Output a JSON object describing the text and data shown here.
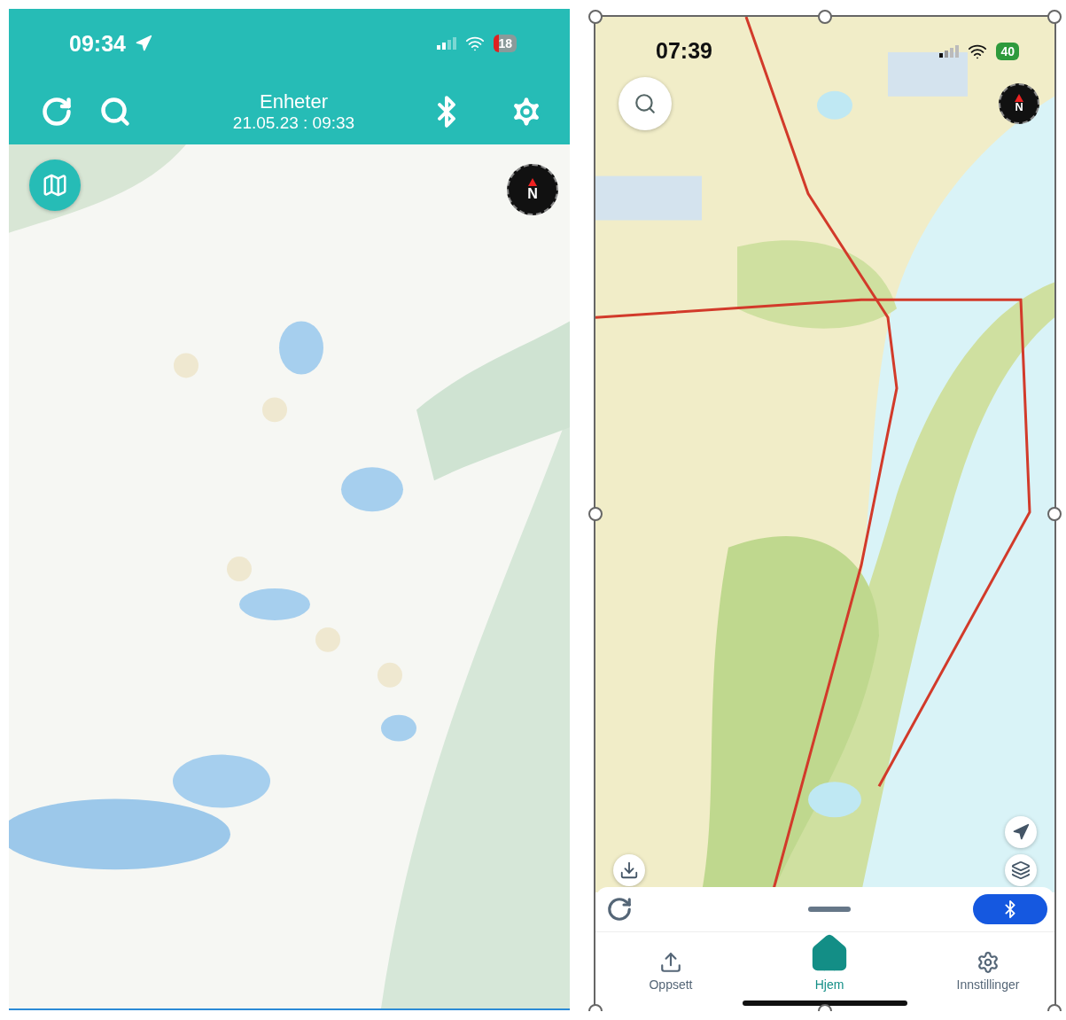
{
  "left_phone": {
    "status_bar": {
      "time": "09:34",
      "battery": "18"
    },
    "toolbar": {
      "title": "Enheter",
      "subtitle": "21.05.23 : 09:33"
    },
    "map": {
      "kind": "picture",
      "compass": "N"
    }
  },
  "right_phone": {
    "status_bar": {
      "time": "07:39",
      "battery": "40"
    },
    "map": {
      "kind": "picture",
      "compass": "N"
    },
    "bluetooth": {
      "on": true
    },
    "tabs": [
      {
        "label": "Oppsett",
        "selected": false
      },
      {
        "label": "Hjem",
        "selected": true
      },
      {
        "label": "Innstillinger",
        "selected": false
      }
    ]
  }
}
